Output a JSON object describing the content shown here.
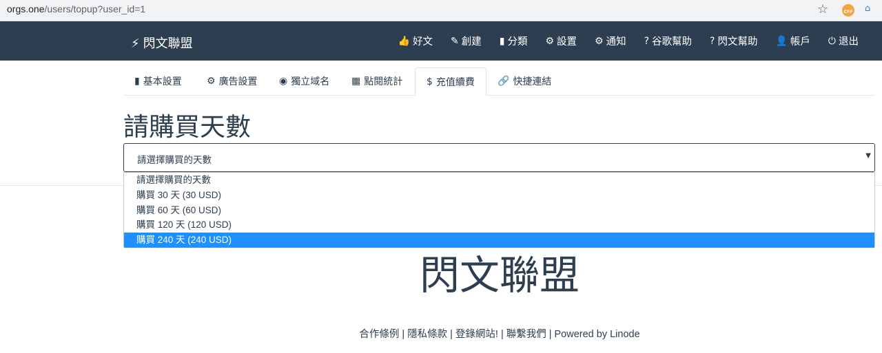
{
  "browser": {
    "url_host": "orgs.one",
    "url_path": "/users/topup?user_id=1",
    "ext_badge": "CFP"
  },
  "navbar": {
    "brand": "閃文聯盟",
    "items": [
      {
        "label": "好文",
        "icon": "thumbs-up-icon",
        "glyph": "👍"
      },
      {
        "label": "創建",
        "icon": "edit-icon",
        "glyph": "✎"
      },
      {
        "label": "分類",
        "icon": "bar-chart-icon",
        "glyph": "▮"
      },
      {
        "label": "設置",
        "icon": "gear-icon",
        "glyph": "⚙"
      },
      {
        "label": "通知",
        "icon": "cog-icon",
        "glyph": "⚙"
      },
      {
        "label": "谷歌幫助",
        "icon": "question-circle-icon",
        "glyph": "?"
      },
      {
        "label": "閃文幫助",
        "icon": "question-circle-icon",
        "glyph": "?"
      },
      {
        "label": "帳戶",
        "icon": "user-icon",
        "glyph": "👤"
      },
      {
        "label": "退出",
        "icon": "power-icon",
        "glyph": "⏻"
      }
    ]
  },
  "tabs": [
    {
      "label": "基本設置",
      "icon": "bookmark-icon",
      "glyph": "▮"
    },
    {
      "label": "廣告設置",
      "icon": "cog-icon",
      "glyph": "⚙"
    },
    {
      "label": "獨立域名",
      "icon": "globe-icon",
      "glyph": "◉"
    },
    {
      "label": "點閱統計",
      "icon": "grid-icon",
      "glyph": "▦"
    },
    {
      "label": "充值續費",
      "icon": "dollar-icon",
      "glyph": "$"
    },
    {
      "label": "快捷連結",
      "icon": "link-icon",
      "glyph": "🔗"
    }
  ],
  "active_tab": "充值續費",
  "heading": "請購買天數",
  "select": {
    "value": "請選擇購買的天數",
    "options": [
      "請選擇購買的天數",
      "購買 30 天 (30 USD)",
      "購買 60 天 (60 USD)",
      "購買 120 天 (120 USD)",
      "購買 240 天 (240 USD)"
    ],
    "highlighted_option": "購買 240 天 (240 USD)",
    "highlight_color": "#1e90ff"
  },
  "logo_text": "閃文聯盟",
  "footer": {
    "links": [
      "合作條例",
      "隱私條款",
      "登錄網站!",
      "聯繫我們"
    ],
    "powered": "Powered by Linode"
  },
  "colors": {
    "navbar_bg": "#2c3e50",
    "text": "#2c3e50"
  }
}
